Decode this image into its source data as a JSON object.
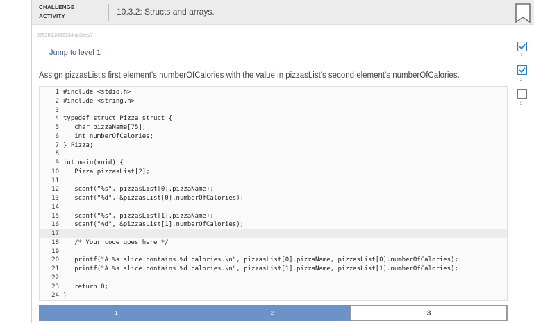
{
  "header": {
    "badge_line1": "CHALLENGE",
    "badge_line2": "ACTIVITY",
    "title": "10.3.2: Structs and arrays."
  },
  "activity_code": "375380.2416134.qx3zqy7",
  "jump_label": "Jump to level 1",
  "prompt": "Assign pizzasList's first element's numberOfCalories with the value in pizzasList's second element's numberOfCalories.",
  "code": {
    "active_line": 17,
    "lines": [
      {
        "n": "1",
        "text": "#include <stdio.h>"
      },
      {
        "n": "2",
        "text": "#include <string.h>"
      },
      {
        "n": "3",
        "text": ""
      },
      {
        "n": "4",
        "text": "typedef struct Pizza_struct {"
      },
      {
        "n": "5",
        "text": "   char pizzaName[75];"
      },
      {
        "n": "6",
        "text": "   int numberOfCalories;"
      },
      {
        "n": "7",
        "text": "} Pizza;"
      },
      {
        "n": "8",
        "text": ""
      },
      {
        "n": "9",
        "text": "int main(void) {"
      },
      {
        "n": "10",
        "text": "   Pizza pizzasList[2];"
      },
      {
        "n": "11",
        "text": ""
      },
      {
        "n": "12",
        "text": "   scanf(\"%s\", pizzasList[0].pizzaName);"
      },
      {
        "n": "13",
        "text": "   scanf(\"%d\", &pizzasList[0].numberOfCalories);"
      },
      {
        "n": "14",
        "text": ""
      },
      {
        "n": "15",
        "text": "   scanf(\"%s\", pizzasList[1].pizzaName);"
      },
      {
        "n": "16",
        "text": "   scanf(\"%d\", &pizzasList[1].numberOfCalories);"
      },
      {
        "n": "17",
        "text": ""
      },
      {
        "n": "18",
        "text": "   /* Your code goes here */"
      },
      {
        "n": "19",
        "text": ""
      },
      {
        "n": "20",
        "text": "   printf(\"A %s slice contains %d calories.\\n\", pizzasList[0].pizzaName, pizzasList[0].numberOfCalories);"
      },
      {
        "n": "21",
        "text": "   printf(\"A %s slice contains %d calories.\\n\", pizzasList[1].pizzaName, pizzasList[1].numberOfCalories);"
      },
      {
        "n": "22",
        "text": ""
      },
      {
        "n": "23",
        "text": "   return 0;"
      },
      {
        "n": "24",
        "text": "}"
      }
    ]
  },
  "levels": [
    {
      "label": "1",
      "state": "completed"
    },
    {
      "label": "2",
      "state": "completed"
    },
    {
      "label": "3",
      "state": "current"
    }
  ],
  "side_levels": [
    {
      "label": "1",
      "checked": true
    },
    {
      "label": "2",
      "checked": true
    },
    {
      "label": "3",
      "checked": false
    }
  ],
  "colors": {
    "accent": "#2f7fc1",
    "level_done": "#6b93c7",
    "header_bg": "#ececec"
  }
}
